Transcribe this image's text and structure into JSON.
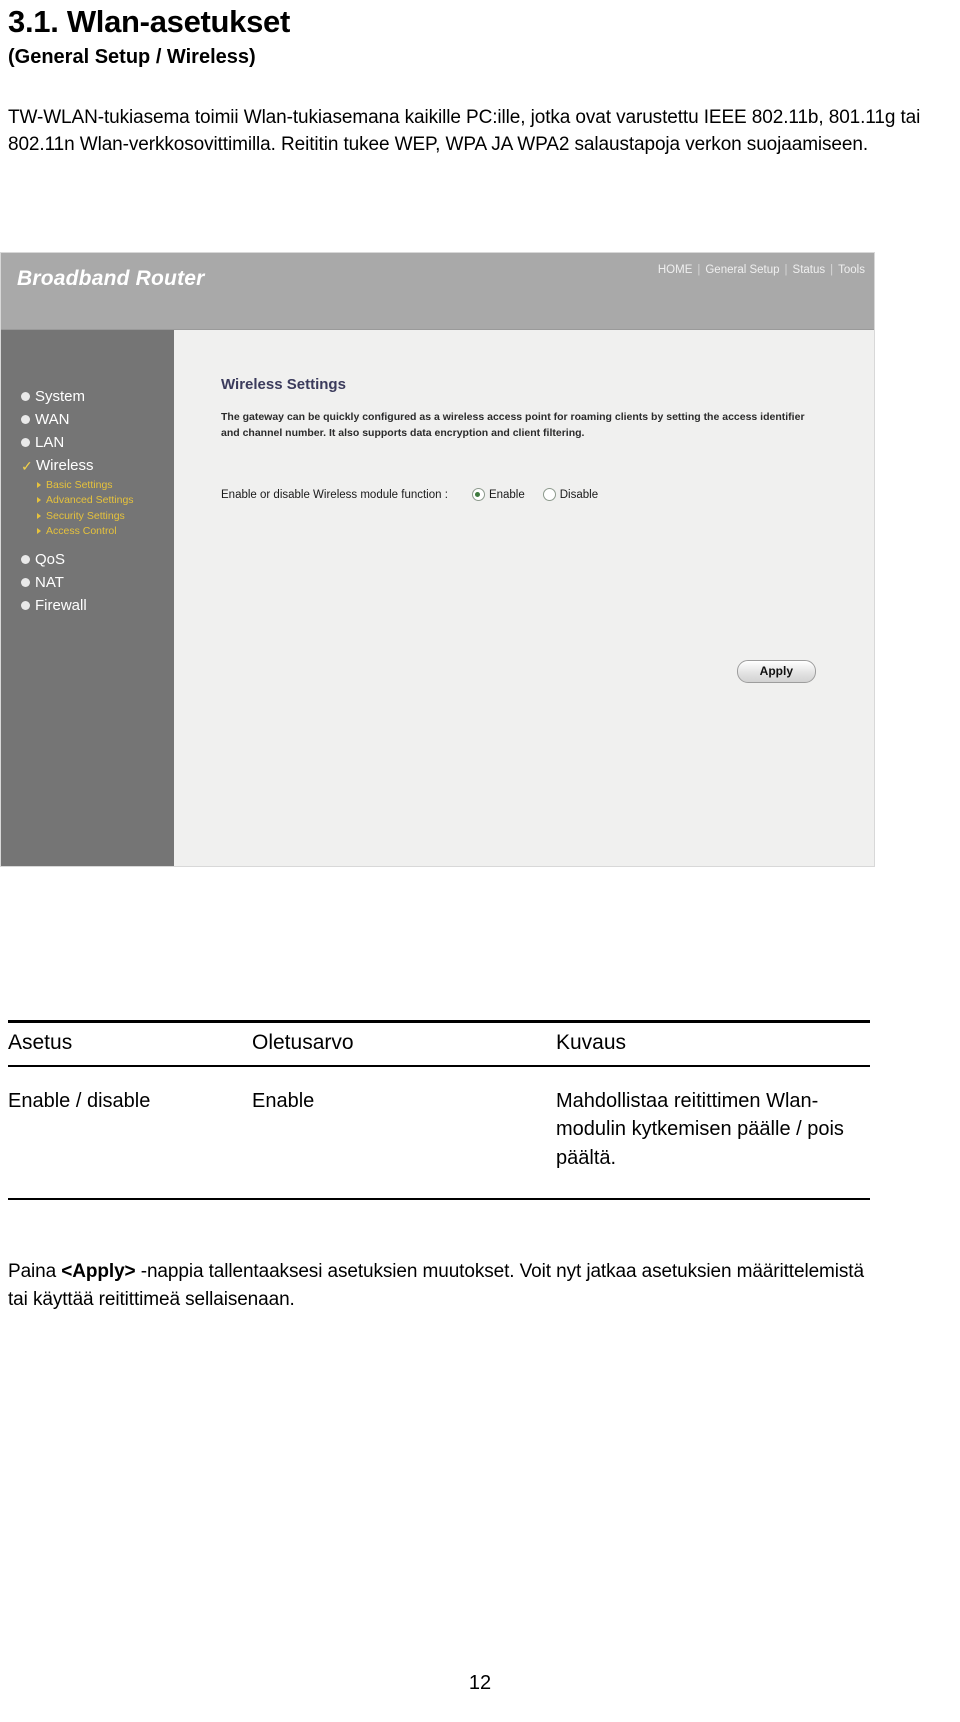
{
  "document": {
    "heading": "3.1. Wlan-asetukset",
    "subheading": "(General Setup / Wireless)",
    "intro": "TW-WLAN-tukiasema toimii Wlan-tukiasemana kaikille PC:ille, jotka ovat varustettu IEEE 802.11b, 801.11g tai 802.11n Wlan-verkkosovittimilla. Reititin tukee WEP, WPA JA WPA2 salaustapoja verkon suojaamiseen.",
    "page_number": "12"
  },
  "router_ui": {
    "brand": "Broadband Router",
    "topnav": [
      {
        "label": "HOME"
      },
      {
        "label": "General Setup"
      },
      {
        "label": "Status"
      },
      {
        "label": "Tools"
      }
    ],
    "nav_separator": "|",
    "sidebar": {
      "items": [
        {
          "label": "System",
          "type": "bullet"
        },
        {
          "label": "WAN",
          "type": "bullet"
        },
        {
          "label": "LAN",
          "type": "bullet"
        },
        {
          "label": "Wireless",
          "type": "check",
          "active": true
        }
      ],
      "sub_items": [
        {
          "label": "Basic Settings"
        },
        {
          "label": "Advanced Settings"
        },
        {
          "label": "Security Settings"
        },
        {
          "label": "Access Control"
        }
      ],
      "items_after": [
        {
          "label": "QoS",
          "type": "bullet"
        },
        {
          "label": "NAT",
          "type": "bullet"
        },
        {
          "label": "Firewall",
          "type": "bullet"
        }
      ],
      "check_glyph": "✓"
    },
    "content": {
      "title": "Wireless Settings",
      "description": "The gateway can be quickly configured as a wireless access point for roaming clients by setting the access identifier and channel number. It also supports data encryption and client filtering.",
      "field_label": "Enable or disable Wireless module function :",
      "options": [
        {
          "label": "Enable",
          "selected": true
        },
        {
          "label": "Disable",
          "selected": false
        }
      ],
      "apply_label": "Apply"
    }
  },
  "settings_table": {
    "headers": {
      "setting": "Asetus",
      "default": "Oletusarvo",
      "description": "Kuvaus"
    },
    "rows": [
      {
        "setting": "Enable / disable",
        "default": "Enable",
        "description": "Mahdollistaa reitittimen Wlan-modulin kytkemisen päälle / pois päältä."
      }
    ]
  },
  "footer_note": {
    "before": "Paina ",
    "bold": "<Apply>",
    "after": " -nappia tallentaaksesi asetuksien muutokset. Voit nyt jatkaa asetuksien määrittelemistä tai käyttää reitittimeä sellaisenaan."
  }
}
